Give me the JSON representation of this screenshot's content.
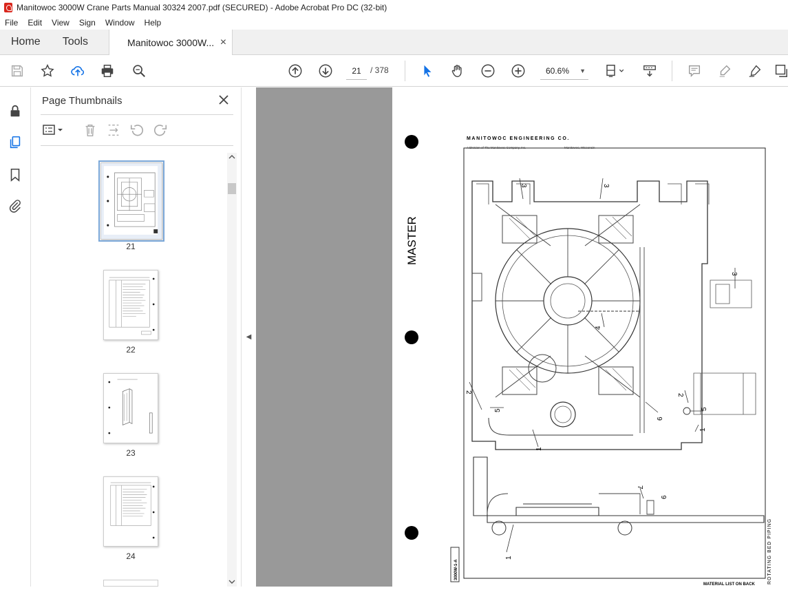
{
  "window": {
    "title": "Manitowoc 3000W Crane Parts Manual 30324 2007.pdf (SECURED) - Adobe Acrobat Pro DC (32-bit)"
  },
  "menu": [
    "File",
    "Edit",
    "View",
    "Sign",
    "Window",
    "Help"
  ],
  "tabs": {
    "home": "Home",
    "tools": "Tools",
    "doc": "Manitowoc 3000W...",
    "doc_close": "×"
  },
  "toolbar": {
    "current_page": "21",
    "total_pages": "/ 378",
    "zoom": "60.6%"
  },
  "thumbnails_panel": {
    "title": "Page Thumbnails",
    "pages": [
      {
        "label": "21",
        "selected": true
      },
      {
        "label": "22",
        "selected": false
      },
      {
        "label": "23",
        "selected": false
      },
      {
        "label": "24",
        "selected": false
      }
    ]
  },
  "document": {
    "company": "MANITOWOC ENGINEERING CO.",
    "division": "A Division of The Manitowoc Company, Inc.",
    "location": "Manitowoc, Wisconsin",
    "stamp": "MASTER",
    "side_title": "ROTATING BED PIPING",
    "drawing_no": "3000W-1-A",
    "footer_note": "MATERIAL LIST ON BACK",
    "callouts": [
      "3",
      "3",
      "3",
      "4",
      "2",
      "5",
      "6",
      "2",
      "5",
      "1",
      "1",
      "1",
      "7",
      "6",
      "1"
    ]
  },
  "colors": {
    "accent": "#1473e6",
    "app_red": "#d9261c",
    "doc_bg": "#999999"
  }
}
